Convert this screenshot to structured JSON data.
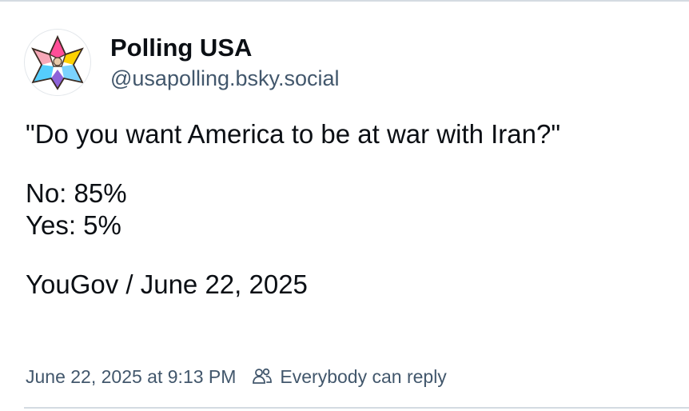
{
  "post": {
    "author": {
      "display_name": "Polling USA",
      "handle": "@usapolling.bsky.social",
      "avatar_icon": "star-logo-icon"
    },
    "text": {
      "question": "\"Do you want America to be at war with Iran?\"",
      "no_line": "No: 85%",
      "yes_line": "Yes: 5%",
      "source_line": "YouGov / June 22, 2025"
    },
    "meta": {
      "timestamp": "June 22, 2025 at 9:13 PM",
      "reply_setting": "Everybody can reply",
      "reply_icon": "people-icon"
    }
  },
  "colors": {
    "text": "#0b0f14",
    "muted": "#42576c",
    "divider": "#d4dbe2"
  }
}
